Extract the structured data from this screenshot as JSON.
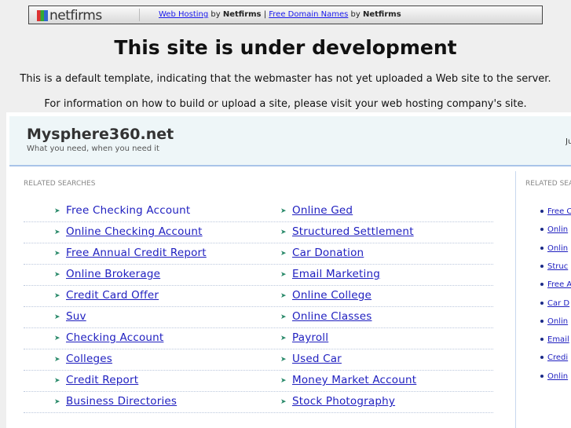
{
  "topbar": {
    "logo": "netfirms",
    "link1": "Web Hosting",
    "by1": "by",
    "brand1": "Netfirms",
    "pipe": "|",
    "link2": "Free Domain Names",
    "by2": "by",
    "brand2": "Netfirms"
  },
  "title": "This site is under development",
  "info1": "This is a default template, indicating that the webmaster has not yet uploaded a Web site to the server.",
  "info2": "For information on how to build or upload a site, please visit your web hosting company's site.",
  "site": {
    "name": "Mysphere360.net",
    "tagline": "What you need, when you need it",
    "right_text": "Ju"
  },
  "related_label": "RELATED SEARCHES",
  "col1": [
    "Free Checking Account",
    "Online Checking Account",
    "Free Annual Credit Report",
    "Online Brokerage",
    "Credit Card Offer",
    "Suv",
    "Checking Account",
    "Colleges",
    "Credit Report",
    "Business Directories"
  ],
  "col2": [
    "Online Ged",
    "Structured Settlement",
    "Car Donation",
    "Email Marketing",
    "Online College",
    "Online Classes",
    "Payroll",
    "Used Car",
    "Money Market Account",
    "Stock Photography"
  ],
  "sidebar": [
    "Free C",
    "Onlin",
    "Onlin",
    "Struc",
    "Free A",
    "Car D",
    "Onlin",
    "Email",
    "Credi",
    "Onlin"
  ]
}
